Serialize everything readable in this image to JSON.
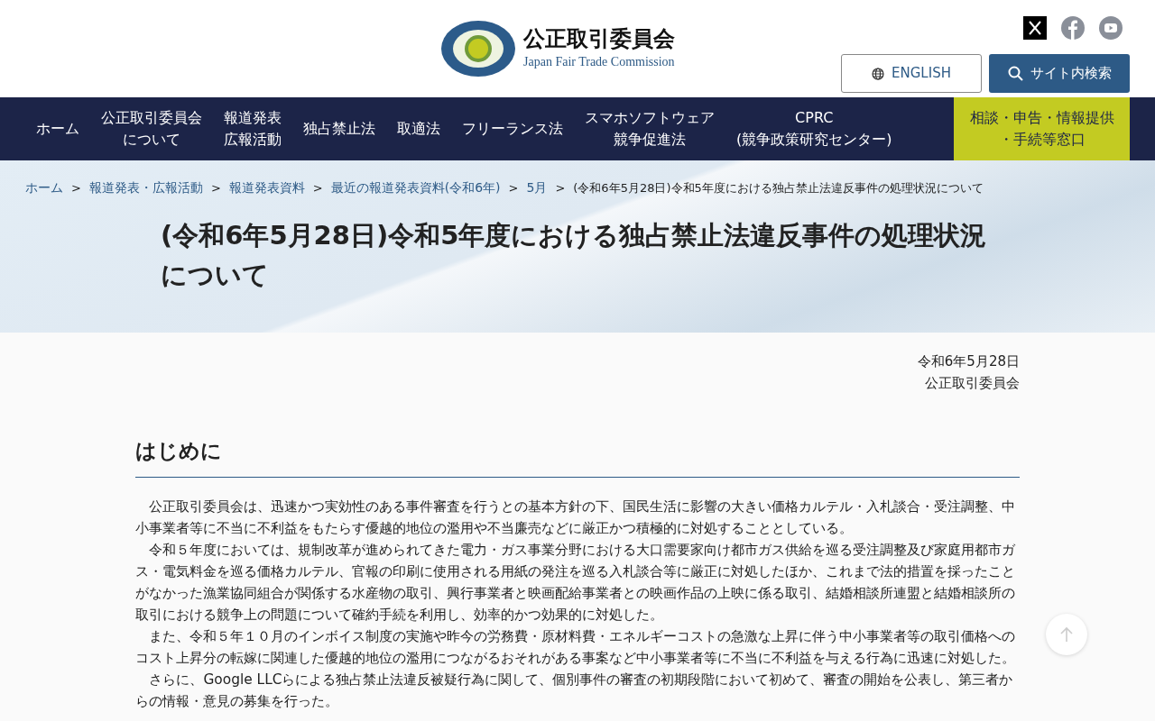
{
  "header": {
    "logo_title": "公正取引委員会",
    "logo_subtitle": "Japan Fair Trade Commission",
    "social": [
      {
        "kind": "x"
      },
      {
        "kind": "facebook"
      },
      {
        "kind": "youtube"
      }
    ],
    "english_button": "ENGLISH",
    "search_button": "サイト内検索"
  },
  "nav": [
    {
      "lines": [
        "ホーム"
      ],
      "highlight": false
    },
    {
      "lines": [
        "公正取引委員会",
        "について"
      ],
      "highlight": false
    },
    {
      "lines": [
        "報道発表",
        "広報活動"
      ],
      "highlight": false
    },
    {
      "lines": [
        "独占禁止法"
      ],
      "highlight": false
    },
    {
      "lines": [
        "取適法"
      ],
      "highlight": false
    },
    {
      "lines": [
        "フリーランス法"
      ],
      "highlight": false
    },
    {
      "lines": [
        "スマホソフトウェア",
        "競争促進法"
      ],
      "highlight": false
    },
    {
      "lines": [
        "CPRC",
        "(競争政策研究センター)"
      ],
      "highlight": false
    },
    {
      "lines": [
        "相談・申告・情報提供",
        "・手続等窓口"
      ],
      "highlight": true
    }
  ],
  "breadcrumb": [
    {
      "label": "ホーム",
      "link": true
    },
    {
      "separator": ">",
      "label": "報道発表・広報活動",
      "link": true
    },
    {
      "separator": ">",
      "label": "報道発表資料",
      "link": true
    },
    {
      "separator": ">",
      "label": "最近の報道発表資料(令和6年)",
      "link": true
    },
    {
      "separator": ">",
      "label": "5月",
      "link": true
    },
    {
      "separator": ">",
      "label": "(令和6年5月28日)令和5年度における独占禁止法違反事件の処理状況について",
      "link": false
    }
  ],
  "page_title": "(令和6年5月28日)令和5年度における独占禁止法違反事件の処理状況について",
  "date": "令和6年5月28日",
  "issuer": "公正取引委員会",
  "section_heading": "はじめに",
  "paragraphs": [
    "公正取引委員会は、迅速かつ実効性のある事件審査を行うとの基本方針の下、国民生活に影響の大きい価格カルテル・入札談合・受注調整、中小事業者等に不当に不利益をもたらす優越的地位の濫用や不当廉売などに厳正かつ積極的に対処することとしている。",
    "令和５年度においては、規制改革が進められてきた電力・ガス事業分野における大口需要家向け都市ガス供給を巡る受注調整及び家庭用都市ガス・電気料金を巡る価格カルテル、官報の印刷に使用される用紙の発注を巡る入札談合等に厳正に対処したほか、これまで法的措置を採ったことがなかった漁業協同組合が関係する水産物の取引、興行事業者と映画配給事業者との映画作品の上映に係る取引、結婚相談所連盟と結婚相談所の取引における競争上の問題について確約手続を利用し、効率的かつ効果的に対処した。",
    "また、令和５年１０月のインボイス制度の実施や昨今の労務費・原材料費・エネルギーコストの急激な上昇に伴う中小事業者等の取引価格へのコスト上昇分の転嫁に関連した優越的地位の濫用につながるおそれがある事案など中小事業者等に不当に不利益を与える行為に迅速に対処した。",
    "さらに、Google LLCらによる独占禁止法違反被疑行為に関して、個別事件の審査の初期段階において初めて、審査の開始を公表し、第三者からの情報・意見の募集を行った。"
  ]
}
